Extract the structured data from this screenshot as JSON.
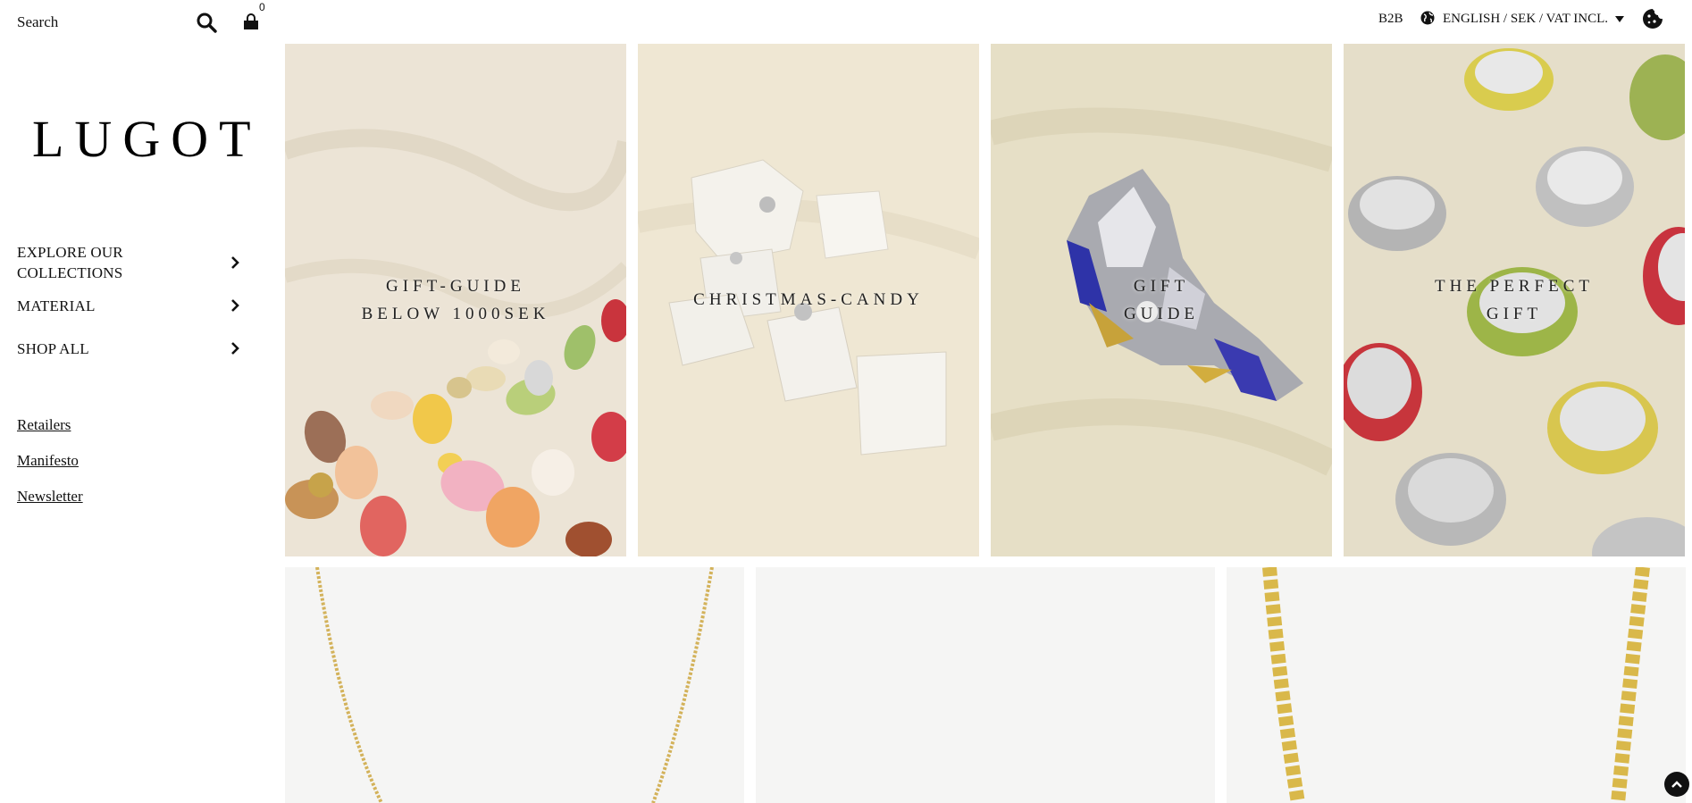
{
  "header": {
    "search_placeholder": "Search",
    "cart_count": "0",
    "b2b_label": "B2B",
    "locale_label": "ENGLISH / SEK / VAT INCL."
  },
  "sidebar": {
    "logo": "LUGOT",
    "menu": [
      {
        "label_line1": "EXPLORE OUR",
        "label_line2": "COLLECTIONS"
      },
      {
        "label": "MATERIAL"
      },
      {
        "label": "SHOP ALL"
      }
    ],
    "links": [
      "Retailers",
      "Manifesto",
      "Newsletter"
    ]
  },
  "hero_tiles": [
    {
      "line1": "GIFT-GUIDE",
      "line2": "BELOW 1000SEK"
    },
    {
      "line1": "CHRISTMAS-CANDY",
      "line2": ""
    },
    {
      "line1": "GIFT",
      "line2": "GUIDE"
    },
    {
      "line1": "THE PERFECT",
      "line2": "GIFT"
    }
  ],
  "colors": {
    "accent": "#111111",
    "background": "#ffffff",
    "product_bg": "#f5f5f4",
    "gold": "#d4b24a"
  },
  "icons": [
    "search-icon",
    "cart-icon",
    "chevron-right-icon",
    "globe-icon",
    "caret-down-icon",
    "cookie-icon",
    "arrow-up-icon"
  ]
}
